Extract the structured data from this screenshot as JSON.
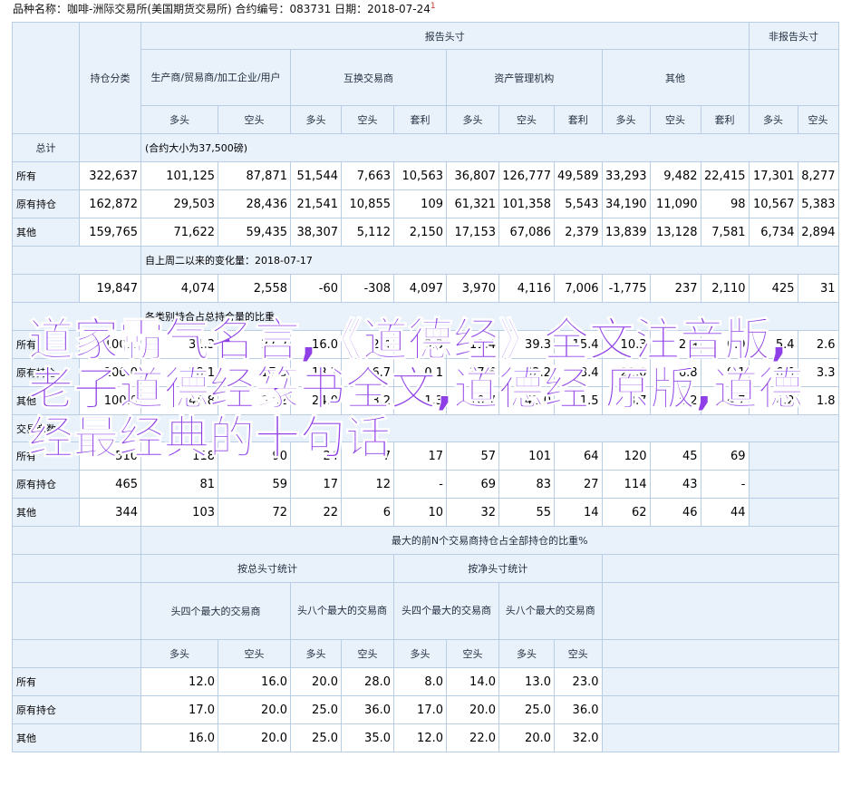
{
  "header": {
    "title": "品种名称：咖啡-洲际交易所(美国期货交易所)   合约编号：083731   日期：2018-07-24",
    "marker": "1"
  },
  "cols": {
    "category": "持仓分类",
    "reportable": "报告头寸",
    "nonreportable": "非报告头寸",
    "producer": "生产商/贸易商/加工企业/用户",
    "swap": "互换交易商",
    "managed": "资产管理机构",
    "other": "其他",
    "total": "总计",
    "long": "多头",
    "short": "空头",
    "spread": "套利"
  },
  "sections": {
    "contract_size": "(合约大小为37,500磅)",
    "change": "自上周二以来的变化量：2018-07-17",
    "pct": "各类别持合占总持合量的比重",
    "traders": "交易商数",
    "concentration": "最大的前N个交易商持仓占全部持仓的比重%",
    "gross": "按总头寸统计",
    "net": "按净头寸统计",
    "top4": "头四个最大的交易商",
    "top8": "头八个最大的交易商"
  },
  "rows": {
    "all": "所有",
    "old": "原有持仓",
    "other": "其他"
  },
  "positions": [
    [
      "322,637",
      "101,125",
      "87,871",
      "51,544",
      "7,663",
      "10,563",
      "36,807",
      "126,777",
      "49,589",
      "33,293",
      "9,482",
      "22,415",
      "17,301",
      "8,277"
    ],
    [
      "162,872",
      "29,503",
      "28,436",
      "21,541",
      "10,855",
      "109",
      "61,321",
      "101,358",
      "5,543",
      "34,190",
      "11,090",
      "98",
      "10,567",
      "5,383"
    ],
    [
      "159,765",
      "71,622",
      "59,435",
      "38,307",
      "5,112",
      "2,150",
      "17,153",
      "67,086",
      "2,379",
      "13,839",
      "13,128",
      "7,581",
      "6,734",
      "2,894"
    ]
  ],
  "changes": [
    "19,847",
    "4,074",
    "2,558",
    "-60",
    "-308",
    "4,097",
    "3,970",
    "4,116",
    "7,006",
    "-1,775",
    "237",
    "2,110",
    "425",
    "31"
  ],
  "percents": [
    [
      "100.0",
      "31.3",
      "27.2",
      "16.0",
      "2.4",
      "3.3",
      "11.4",
      "39.3",
      "15.4",
      "10.3",
      "2.9",
      "6.9",
      "5.4",
      "2.6"
    ],
    [
      "100.0",
      "18.1",
      "17.5",
      "13.2",
      "6.7",
      "0.1",
      "37.6",
      "62.2",
      "3.4",
      "21.0",
      "6.8",
      "0.1",
      "6.5",
      "3.3"
    ],
    [
      "100.0",
      "44.8",
      "37.2",
      "24.0",
      "3.2",
      "1.3",
      "10.7",
      "42.0",
      "1.5",
      "8.7",
      "8.2",
      "4.7",
      "4.2",
      "1.8"
    ]
  ],
  "traders": [
    [
      "510",
      "118",
      "90",
      "24",
      "7",
      "17",
      "57",
      "101",
      "64",
      "120",
      "45",
      "69"
    ],
    [
      "465",
      "81",
      "59",
      "17",
      "12",
      "-",
      "69",
      "83",
      "27",
      "114",
      "43",
      "-"
    ],
    [
      "344",
      "103",
      "72",
      "22",
      "6",
      "10",
      "32",
      "55",
      "14",
      "62",
      "46",
      "44"
    ]
  ],
  "concentration_rows": [
    [
      "12.0",
      "16.0",
      "20.0",
      "28.0",
      "8.0",
      "14.0",
      "13.0",
      "23.0"
    ],
    [
      "17.0",
      "20.0",
      "25.0",
      "36.0",
      "17.0",
      "20.0",
      "25.0",
      "36.0"
    ],
    [
      "16.0",
      "20.0",
      "25.0",
      "35.0",
      "12.0",
      "22.0",
      "20.0",
      "32.0"
    ]
  ],
  "overlay_text": "道家霸气名言,《道德经》全文注音版,老子道德经篆书全文,道德经 原版,道德经最经典的十句话"
}
